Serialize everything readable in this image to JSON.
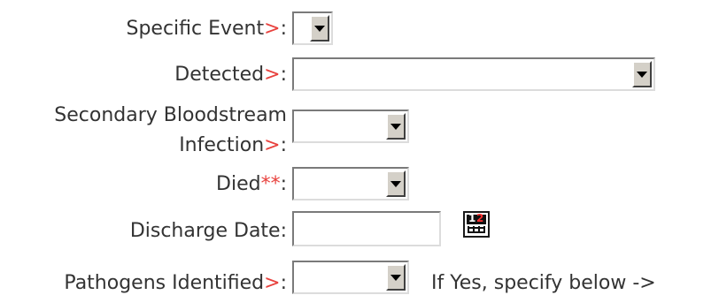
{
  "form": {
    "specific_event": {
      "label": "Specific Event",
      "mark": ">",
      "suffix": ":",
      "value": ""
    },
    "detected": {
      "label": "Detected",
      "mark": ">",
      "suffix": ":",
      "value": ""
    },
    "secondary_bsi": {
      "label_line1": "Secondary Bloodstream",
      "label_line2": "Infection",
      "mark": ">",
      "suffix": ":",
      "value": ""
    },
    "died": {
      "label": "Died",
      "mark": "**",
      "suffix": ":",
      "value": ""
    },
    "discharge_date": {
      "label": "Discharge Date:",
      "value": ""
    },
    "pathogens": {
      "label": "Pathogens Identified",
      "mark": ">",
      "suffix": ":",
      "value": "",
      "note": "If Yes, specify below ->"
    }
  },
  "colors": {
    "required_marker": "#e8413d",
    "label_text": "#333333",
    "button_face": "#d4d0c8"
  },
  "icons": {
    "calendar": "calendar-icon",
    "dropdown": "chevron-down-icon"
  }
}
